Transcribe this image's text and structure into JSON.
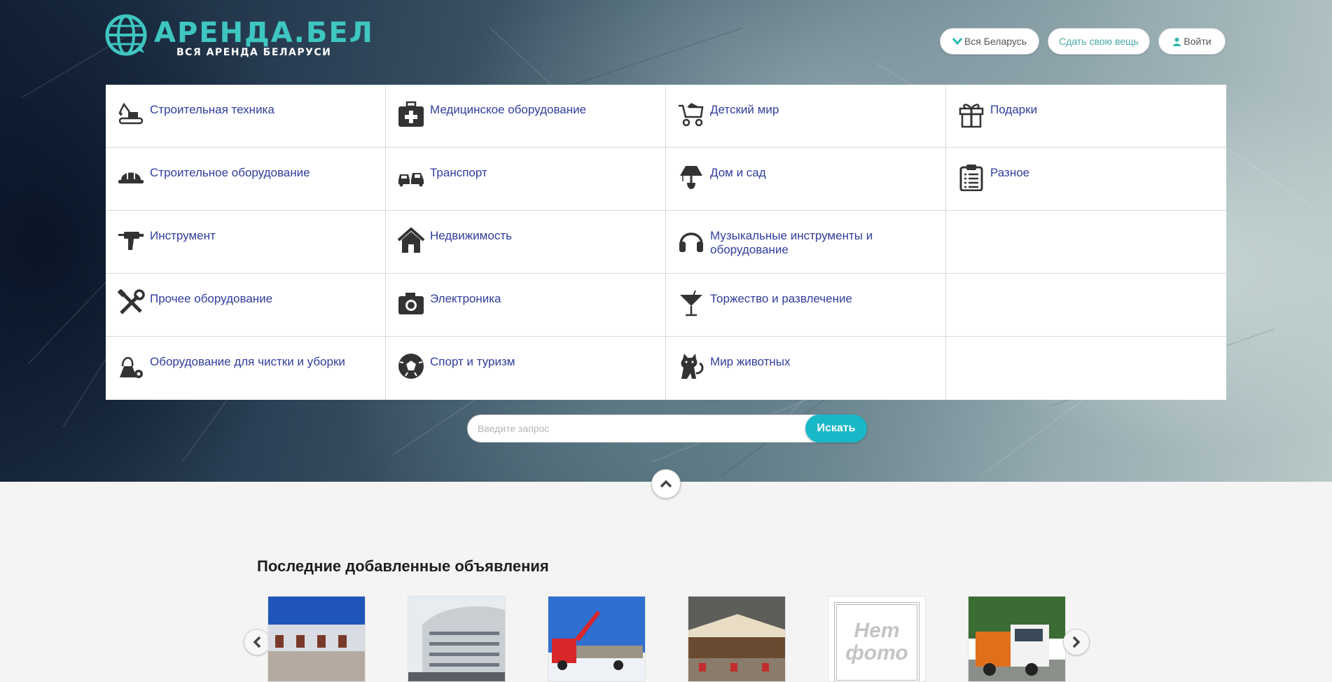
{
  "brand": {
    "title": "АРЕНДА.БЕЛ",
    "subtitle": "ВСЯ АРЕНДА БЕЛАРУСИ",
    "accent_color": "#3ec6c1"
  },
  "header": {
    "region_label": "Вся Беларусь",
    "post_label": "Сдать свою вещь",
    "login_label": "Войти"
  },
  "categories": [
    {
      "label": "Строительная техника",
      "icon": "excavator-icon"
    },
    {
      "label": "Медицинское оборудование",
      "icon": "medical-kit-icon"
    },
    {
      "label": "Детский мир",
      "icon": "stroller-icon"
    },
    {
      "label": "Подарки",
      "icon": "gift-icon"
    },
    {
      "label": "Строительное оборудование",
      "icon": "hard-hat-icon"
    },
    {
      "label": "Транспорт",
      "icon": "cars-icon"
    },
    {
      "label": "Дом и сад",
      "icon": "lamp-icon"
    },
    {
      "label": "Разное",
      "icon": "clipboard-icon"
    },
    {
      "label": "Инструмент",
      "icon": "drill-icon"
    },
    {
      "label": "Недвижимость",
      "icon": "house-icon"
    },
    {
      "label": "Музыкальные инструменты и оборудование",
      "icon": "headphones-icon"
    },
    {
      "label": "",
      "icon": ""
    },
    {
      "label": "Прочее оборудование",
      "icon": "tools-icon"
    },
    {
      "label": "Электроника",
      "icon": "camera-icon"
    },
    {
      "label": "Торжество и развлечение",
      "icon": "cocktail-icon"
    },
    {
      "label": "",
      "icon": ""
    },
    {
      "label": "Оборудование для чистки и уборки",
      "icon": "vacuum-icon"
    },
    {
      "label": "Спорт и туризм",
      "icon": "soccer-ball-icon"
    },
    {
      "label": "Мир животных",
      "icon": "cat-icon"
    },
    {
      "label": "",
      "icon": ""
    }
  ],
  "search": {
    "placeholder": "Введите запрос",
    "button_label": "Искать"
  },
  "latest": {
    "title": "Последние добавленные объявления",
    "no_photo_text": [
      "Нет",
      "фото"
    ],
    "items": [
      {
        "image": "warehouse-photo"
      },
      {
        "image": "office-building-photo"
      },
      {
        "image": "crane-truck-photo"
      },
      {
        "image": "cafe-terrace-photo"
      },
      {
        "image": "no-photo-placeholder"
      },
      {
        "image": "dump-truck-photo"
      }
    ]
  }
}
